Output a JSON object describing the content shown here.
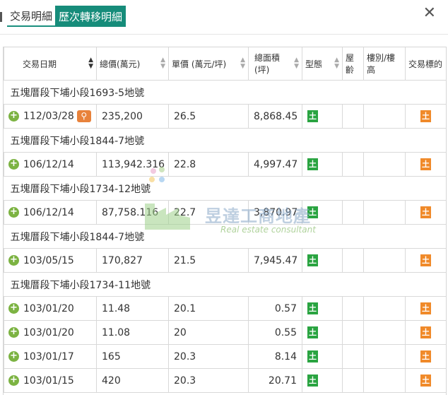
{
  "tabs": [
    {
      "label": "交易明細"
    },
    {
      "label": "歷次轉移明細"
    }
  ],
  "close_symbol": "✕",
  "table": {
    "columns": [
      "交易日期",
      "總價(萬元)",
      "單價 (萬元/坪)",
      "總面積\n(坪)",
      "型態",
      "屋齡",
      "樓別/樓高",
      "交易標的"
    ],
    "groups": [
      {
        "title": "五塊厝段下埔小段1693-5地號",
        "rows": [
          {
            "date": "112/03/28",
            "total": "235,200",
            "unit": "26.5",
            "area": "8,868.45",
            "type": "土",
            "target": "土",
            "magnify": true
          }
        ]
      },
      {
        "title": "五塊厝段下埔小段1844-7地號",
        "rows": [
          {
            "date": "106/12/14",
            "total": "113,942.316",
            "unit": "22.8",
            "area": "4,997.47",
            "type": "土",
            "target": "土"
          }
        ]
      },
      {
        "title": "五塊厝段下埔小段1734-12地號",
        "rows": [
          {
            "date": "106/12/14",
            "total": "87,758.116",
            "unit": "22.7",
            "area": "3,870.97",
            "type": "土",
            "target": "土"
          }
        ]
      },
      {
        "title": "五塊厝段下埔小段1844-7地號",
        "rows": [
          {
            "date": "103/05/15",
            "total": "170,827",
            "unit": "21.5",
            "area": "7,945.47",
            "type": "土",
            "target": "土"
          }
        ]
      },
      {
        "title": "五塊厝段下埔小段1734-11地號",
        "rows": [
          {
            "date": "103/01/20",
            "total": "11.48",
            "unit": "20.1",
            "area": "0.57",
            "type": "土",
            "target": "土"
          },
          {
            "date": "103/01/20",
            "total": "11.08",
            "unit": "20",
            "area": "0.55",
            "type": "土",
            "target": "土"
          },
          {
            "date": "103/01/17",
            "total": "165",
            "unit": "20.3",
            "area": "8.14",
            "type": "土",
            "target": "土"
          },
          {
            "date": "103/01/15",
            "total": "420",
            "unit": "20.3",
            "area": "20.71",
            "type": "土",
            "target": "土"
          }
        ]
      }
    ]
  },
  "watermark": {
    "name": "昱達工商地產",
    "tagline": "Real estate consultant"
  }
}
